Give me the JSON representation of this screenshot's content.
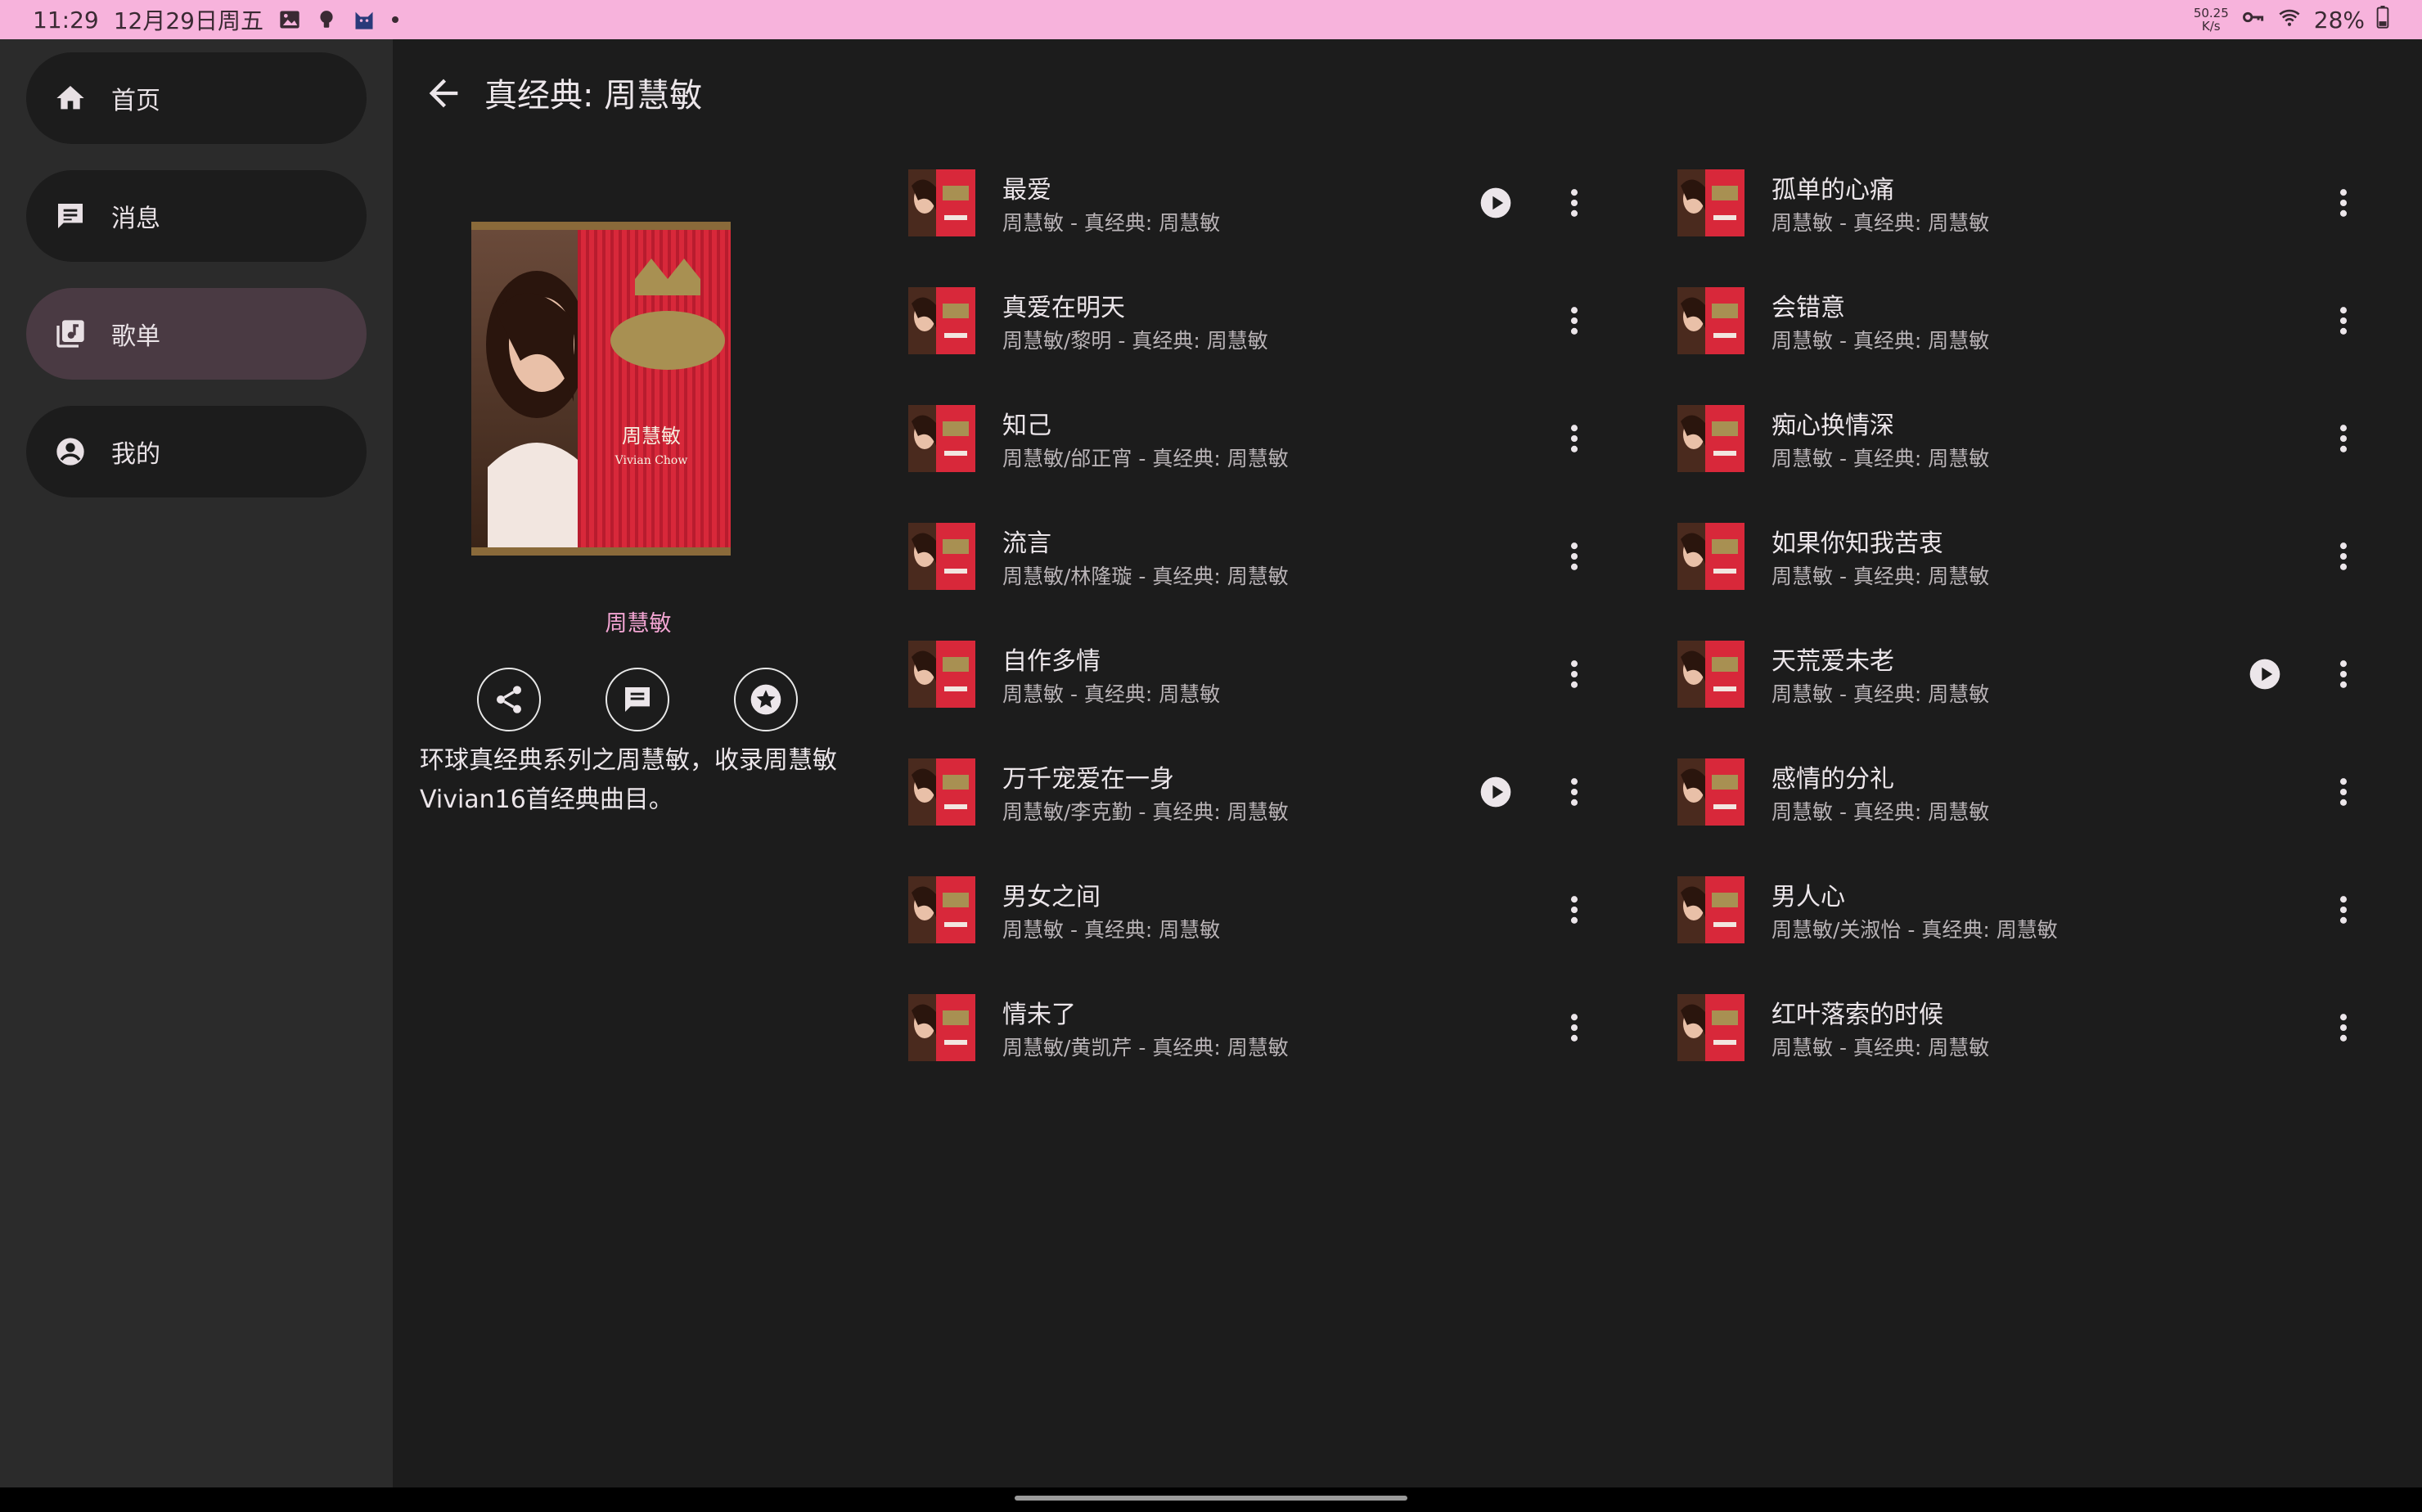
{
  "status": {
    "time": "11:29",
    "date": "12月29日周五",
    "net_speed": "50.25",
    "net_unit": "K/s",
    "battery": "28%"
  },
  "nav": [
    {
      "label": "首页",
      "icon": "home-icon"
    },
    {
      "label": "消息",
      "icon": "message-icon"
    },
    {
      "label": "歌单",
      "icon": "playlist-icon",
      "active": true
    },
    {
      "label": "我的",
      "icon": "account-icon"
    }
  ],
  "header": {
    "title": "真经典: 周慧敏"
  },
  "album": {
    "cover_label": "周慧敏",
    "cover_sub": "Vivian Chow",
    "artist": "周慧敏",
    "description": "环球真经典系列之周慧敏，收录周慧敏Vivian16首经典曲目。"
  },
  "songs": [
    {
      "title": "最爱",
      "subtitle": "周慧敏 - 真经典: 周慧敏",
      "play": true
    },
    {
      "title": "真爱在明天",
      "subtitle": "周慧敏/黎明 - 真经典: 周慧敏",
      "play": false
    },
    {
      "title": "知己",
      "subtitle": "周慧敏/邰正宵 - 真经典: 周慧敏",
      "play": false
    },
    {
      "title": "流言",
      "subtitle": "周慧敏/林隆璇 - 真经典: 周慧敏",
      "play": false
    },
    {
      "title": "自作多情",
      "subtitle": "周慧敏 - 真经典: 周慧敏",
      "play": false
    },
    {
      "title": "万千宠爱在一身",
      "subtitle": "周慧敏/李克勤 - 真经典: 周慧敏",
      "play": true
    },
    {
      "title": "男女之间",
      "subtitle": "周慧敏 - 真经典: 周慧敏",
      "play": false
    },
    {
      "title": "情未了",
      "subtitle": "周慧敏/黄凯芹 - 真经典: 周慧敏",
      "play": false
    },
    {
      "title": "孤单的心痛",
      "subtitle": "周慧敏 - 真经典: 周慧敏",
      "play": false
    },
    {
      "title": "会错意",
      "subtitle": "周慧敏 - 真经典: 周慧敏",
      "play": false
    },
    {
      "title": "痴心换情深",
      "subtitle": "周慧敏 - 真经典: 周慧敏",
      "play": false
    },
    {
      "title": "如果你知我苦衷",
      "subtitle": "周慧敏 - 真经典: 周慧敏",
      "play": false
    },
    {
      "title": "天荒爱未老",
      "subtitle": "周慧敏 - 真经典: 周慧敏",
      "play": true
    },
    {
      "title": "感情的分礼",
      "subtitle": "周慧敏 - 真经典: 周慧敏",
      "play": false
    },
    {
      "title": "男人心",
      "subtitle": "周慧敏/关淑怡 - 真经典: 周慧敏",
      "play": false
    },
    {
      "title": "红叶落索的时候",
      "subtitle": "周慧敏 - 真经典: 周慧敏",
      "play": false
    }
  ]
}
